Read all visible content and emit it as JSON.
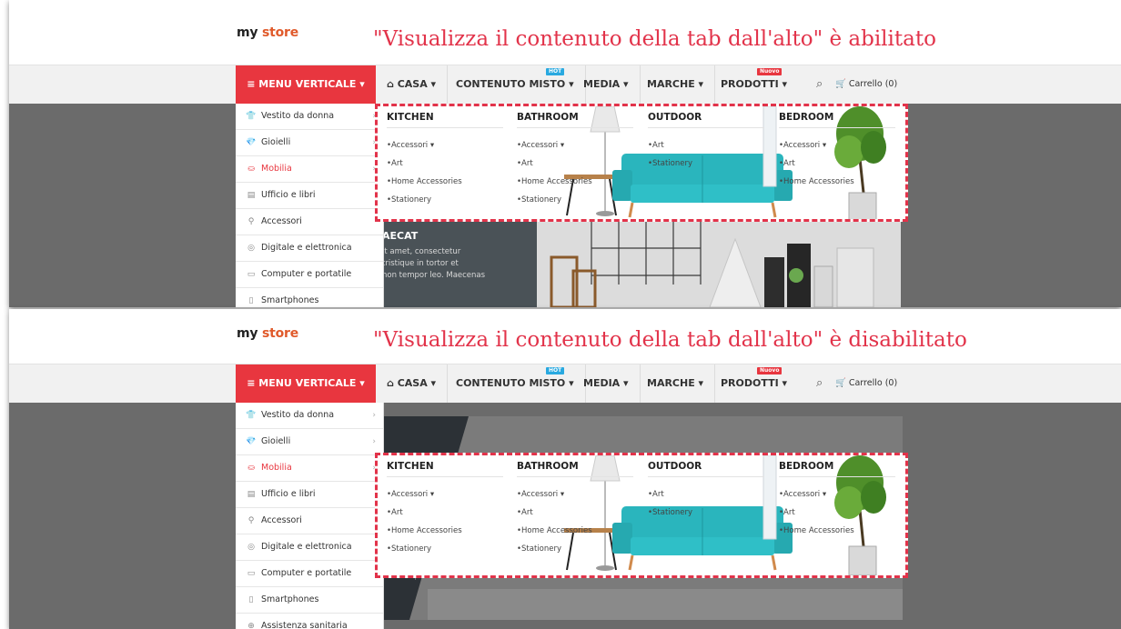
{
  "store": {
    "logo_part1": "my ",
    "logo_part2": "store"
  },
  "captions": {
    "enabled": "\"Visualizza il contenuto della tab dall'alto\" è abilitato",
    "disabled": "\"Visualizza il contenuto della tab dall'alto\" è disabilitato"
  },
  "nav": {
    "menu_vertical": "≡ MENU VERTICALE ▾",
    "casa": "⌂ CASA ▾",
    "contenuto_misto": "CONTENUTO MISTO ▾",
    "media": "MEDIA ▾",
    "marche": "MARCHE ▾",
    "prodotti": "PRODOTTI ▾",
    "hot_tag": "HOT",
    "new_tag": "Nuovo",
    "search_icon": "⌕",
    "cart": "🛒 Carrello (0)"
  },
  "sidebar": {
    "items": [
      {
        "icon": "👕",
        "label": "Vestito da donna",
        "arrow": "›"
      },
      {
        "icon": "💎",
        "label": "Gioielli",
        "arrow": "›"
      },
      {
        "icon": "⛀",
        "label": "Mobilia",
        "arrow": "›"
      },
      {
        "icon": "▤",
        "label": "Ufficio e libri",
        "arrow": ""
      },
      {
        "icon": "⚲",
        "label": "Accessori",
        "arrow": ""
      },
      {
        "icon": "◎",
        "label": "Digitale e elettronica",
        "arrow": ""
      },
      {
        "icon": "▭",
        "label": "Computer e portatile",
        "arrow": ""
      },
      {
        "icon": "▯",
        "label": "Smartphones",
        "arrow": ""
      },
      {
        "icon": "⊕",
        "label": "Assistenza sanitaria",
        "arrow": ""
      }
    ]
  },
  "hero": {
    "title": "AECAT",
    "text_line1": "it amet, consectetur",
    "text_line2": "tristique in tortor et",
    "text_line3": "non tempor leo. Maecenas",
    "text_bottom": "non tempor leo. Maecenas"
  },
  "mega": {
    "columns": [
      {
        "title": "KITCHEN",
        "items": [
          "Accessori ▾",
          "Art",
          "Home Accessories",
          "Stationery"
        ]
      },
      {
        "title": "BATHROOM",
        "items": [
          "Accessori ▾",
          "Art",
          "Home Accessories",
          "Stationery"
        ]
      },
      {
        "title": "OUTDOOR",
        "items": [
          "Art",
          "Stationery"
        ]
      },
      {
        "title": "BEDROOM",
        "items": [
          "Accessori ▾",
          "Art",
          "Home Accessories"
        ]
      }
    ]
  },
  "colors": {
    "accent": "#e8363f",
    "caption": "#e2334a",
    "sofa": "#2ab5bd"
  }
}
